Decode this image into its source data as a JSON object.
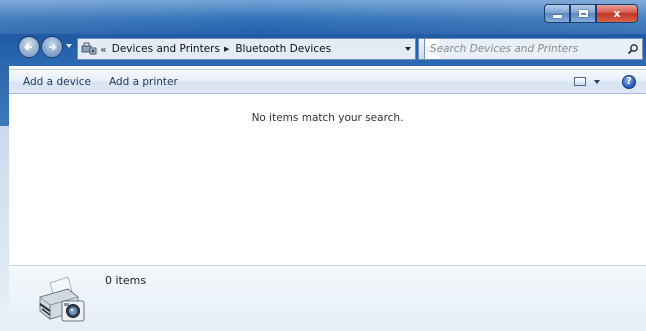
{
  "window": {
    "caption_buttons": [
      "minimize",
      "maximize",
      "close"
    ],
    "close_label": "x"
  },
  "nav": {
    "back_icon": "back-arrow-icon",
    "forward_icon": "forward-arrow-icon"
  },
  "address": {
    "overflow": "«",
    "crumbs": [
      "Devices and Printers",
      "Bluetooth Devices"
    ]
  },
  "search": {
    "placeholder": "Search Devices and Printers"
  },
  "commandbar": {
    "add_device": "Add a device",
    "add_printer": "Add a printer",
    "help": "?"
  },
  "content": {
    "empty_message": "No items match your search."
  },
  "details": {
    "item_count": "0 items"
  },
  "colors": {
    "accent": "#1f5aa5",
    "command_text": "#1e395b"
  }
}
